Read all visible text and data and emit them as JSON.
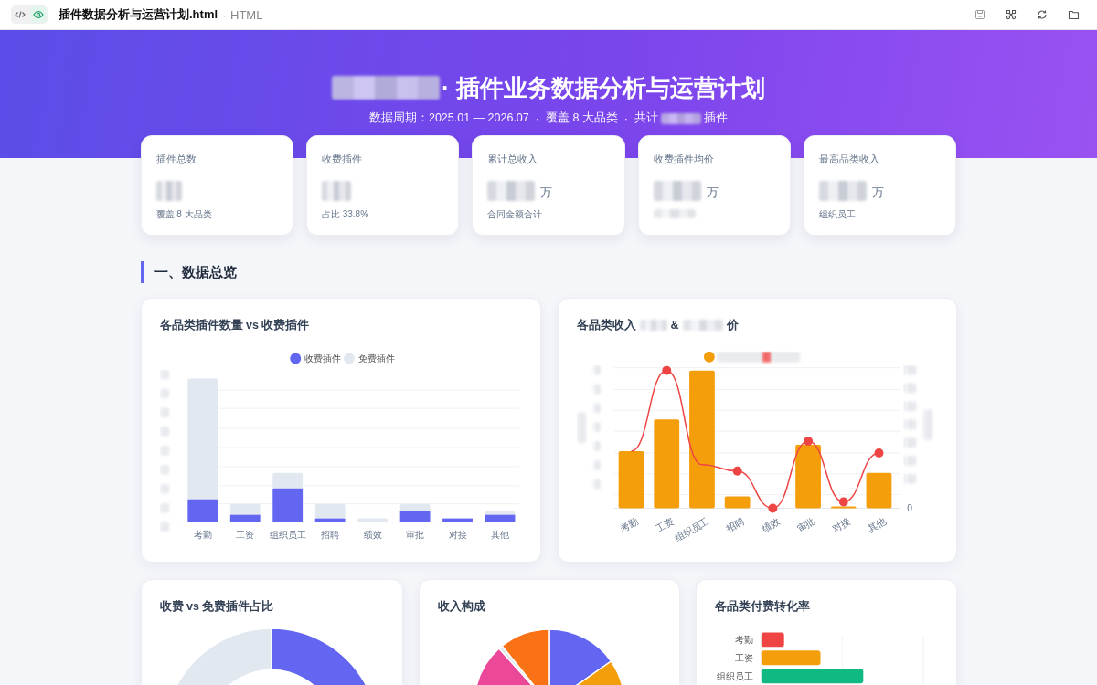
{
  "top_bar": {
    "view_tabs": [
      {
        "kind": "code",
        "selected": false
      },
      {
        "kind": "preview",
        "selected": true
      }
    ],
    "file_name": "插件数据分析与运营计划.html",
    "file_type": "· HTML",
    "actions": [
      {
        "kind": "save"
      },
      {
        "kind": "capture"
      },
      {
        "kind": "refresh"
      },
      {
        "kind": "folder"
      }
    ]
  },
  "header": {
    "title": "· 插件业务数据分析与运营计划",
    "subtitle": [
      {
        "text": "数据周期：2025.01 — 2026.07"
      },
      {
        "text": "·"
      },
      {
        "text": "覆盖 8 大品类"
      },
      {
        "text": "·"
      },
      {
        "text": "共计",
        "redacted_after": true
      },
      {
        "text": "插件"
      }
    ]
  },
  "stat_cards": [
    {
      "label": "插件总数",
      "note": "覆盖 8 大品类"
    },
    {
      "label": "收费插件",
      "note": "占比 33.8%"
    },
    {
      "label": "累计总收入",
      "unit": "万",
      "note": "合同金额合计"
    },
    {
      "label": "收费插件均价",
      "unit": "万"
    },
    {
      "label": "最高品类收入",
      "unit": "万",
      "note": "组织员工"
    }
  ],
  "section_title": "一、数据总览",
  "charts": [
    {
      "kind": "stacked_bar",
      "title_parts": [
        "各品类插件数量 vs 收费插件"
      ],
      "legend": [
        {
          "label": "收费插件",
          "color": "#6366f1"
        },
        {
          "label": "免费插件",
          "color": "#e2e8f0"
        }
      ],
      "categories": [
        "考勤",
        "工资",
        "组织员工",
        "招聘",
        "绩效",
        "审批",
        "对接",
        "其他"
      ]
    },
    {
      "kind": "bar_line",
      "title_parts": [
        "各品类收入",
        "&",
        "价"
      ],
      "categories": [
        "考勤",
        "工资",
        "组织员工",
        "招聘",
        "绩效",
        "审批",
        "对接",
        "其他"
      ],
      "right_axis_label": "0"
    },
    {
      "kind": "donut",
      "title_parts": [
        "收费 vs 免费插件占比"
      ]
    },
    {
      "kind": "pie",
      "title_parts": [
        "收入构成"
      ]
    },
    {
      "kind": "hbar",
      "title_parts": [
        "各品类付费转化率"
      ],
      "categories": [
        "考勤",
        "工资",
        "组织员工"
      ]
    }
  ]
}
